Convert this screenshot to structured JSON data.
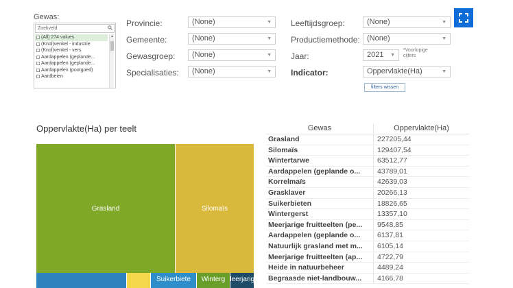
{
  "filters": {
    "gewas": {
      "label": "Gewas:",
      "search_placeholder": "Zoekveld",
      "items": [
        "(All) 274 values",
        "(Knol)venkel - industrie",
        "(Knol)venkel - vers",
        "Aardappelen (geplande...",
        "Aardappelen (geplande...",
        "Aardappelen (pootgoed)",
        "Aardbeien"
      ]
    },
    "provincie": {
      "label": "Provincie:",
      "value": "(None)"
    },
    "gemeente": {
      "label": "Gemeente:",
      "value": "(None)"
    },
    "gewasgroep": {
      "label": "Gewasgroep:",
      "value": "(None)"
    },
    "specialisaties": {
      "label": "Specialisaties:",
      "value": "(None)"
    },
    "leeftijdsgroep": {
      "label": "Leeftijdsgroep:",
      "value": "(None)"
    },
    "productiemethode": {
      "label": "Productiemethode:",
      "value": "(None)"
    },
    "jaar": {
      "label": "Jaar:",
      "value": "2021",
      "note": "*Voorlopige cijfers"
    },
    "indicator": {
      "label": "Indicator:",
      "value": "Oppervlakte(Ha)"
    },
    "clear_label": "filters wissen"
  },
  "treemap": {
    "title": "Oppervlakte(Ha) per teelt",
    "tiles": [
      {
        "label": "Grasland",
        "color": "#7fa728"
      },
      {
        "label": "Silomaïs",
        "color": "#d9b93b"
      },
      {
        "label": "",
        "color": "#2f83bd"
      },
      {
        "label": "",
        "color": "#f5d94a"
      },
      {
        "label": "Suikerbiete",
        "color": "#2e8ec9"
      },
      {
        "label": "Winterg",
        "color": "#6a9e2a"
      },
      {
        "label": "Meerjarige",
        "color": "#1e4b66"
      }
    ]
  },
  "table": {
    "headers": [
      "Gewas",
      "Oppervlakte(Ha)"
    ],
    "rows": [
      [
        "Grasland",
        "227205,44"
      ],
      [
        "Silomaïs",
        "129407,54"
      ],
      [
        "Wintertarwe",
        "63512,77"
      ],
      [
        "Aardappelen (geplande o...",
        "43789,01"
      ],
      [
        "Korrelmaïs",
        "42639,03"
      ],
      [
        "Grasklaver",
        "20266,13"
      ],
      [
        "Suikerbieten",
        "18826,65"
      ],
      [
        "Wintergerst",
        "13357,10"
      ],
      [
        "Meerjarige fruitteelten (pe...",
        "9548,85"
      ],
      [
        "Aardappelen (geplande o...",
        "6137,81"
      ],
      [
        "Natuurlijk grasland met m...",
        "6105,14"
      ],
      [
        "Meerjarige fruitteelten (ap...",
        "4722,79"
      ],
      [
        "Heide in natuurbeheer",
        "4489,24"
      ],
      [
        "Begraasde niet-landbouw...",
        "4166,78"
      ]
    ]
  },
  "icons": {
    "search": "search-icon",
    "expand": "expand-icon",
    "dropdown": "chevron-down-icon"
  }
}
